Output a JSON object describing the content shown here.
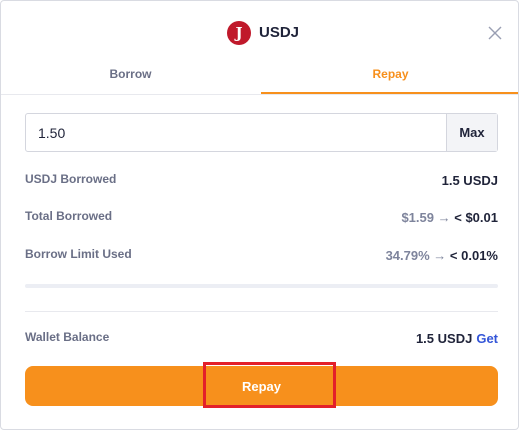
{
  "modal": {
    "title": "USDJ",
    "coin_icon_letter": "J",
    "close_icon": "close-icon"
  },
  "tabs": [
    {
      "label": "Borrow",
      "active": false
    },
    {
      "label": "Repay",
      "active": true
    }
  ],
  "amount": {
    "value": "1.50",
    "max_label": "Max"
  },
  "rows": {
    "borrowed": {
      "label": "USDJ Borrowed",
      "value": "1.5 USDJ"
    },
    "total_borrowed": {
      "label": "Total Borrowed",
      "from": "$1.59",
      "arrow": "→",
      "to": "< $0.01"
    },
    "limit_used": {
      "label": "Borrow Limit Used",
      "from": "34.79%",
      "arrow": "→",
      "to": "< 0.01%"
    }
  },
  "wallet": {
    "label": "Wallet Balance",
    "value": "1.5 USDJ",
    "get_label": "Get"
  },
  "action": {
    "repay_label": "Repay"
  },
  "colors": {
    "accent": "#f7901c",
    "coin": "#c0192b",
    "link": "#3355d8",
    "highlight": "#e3202a"
  }
}
